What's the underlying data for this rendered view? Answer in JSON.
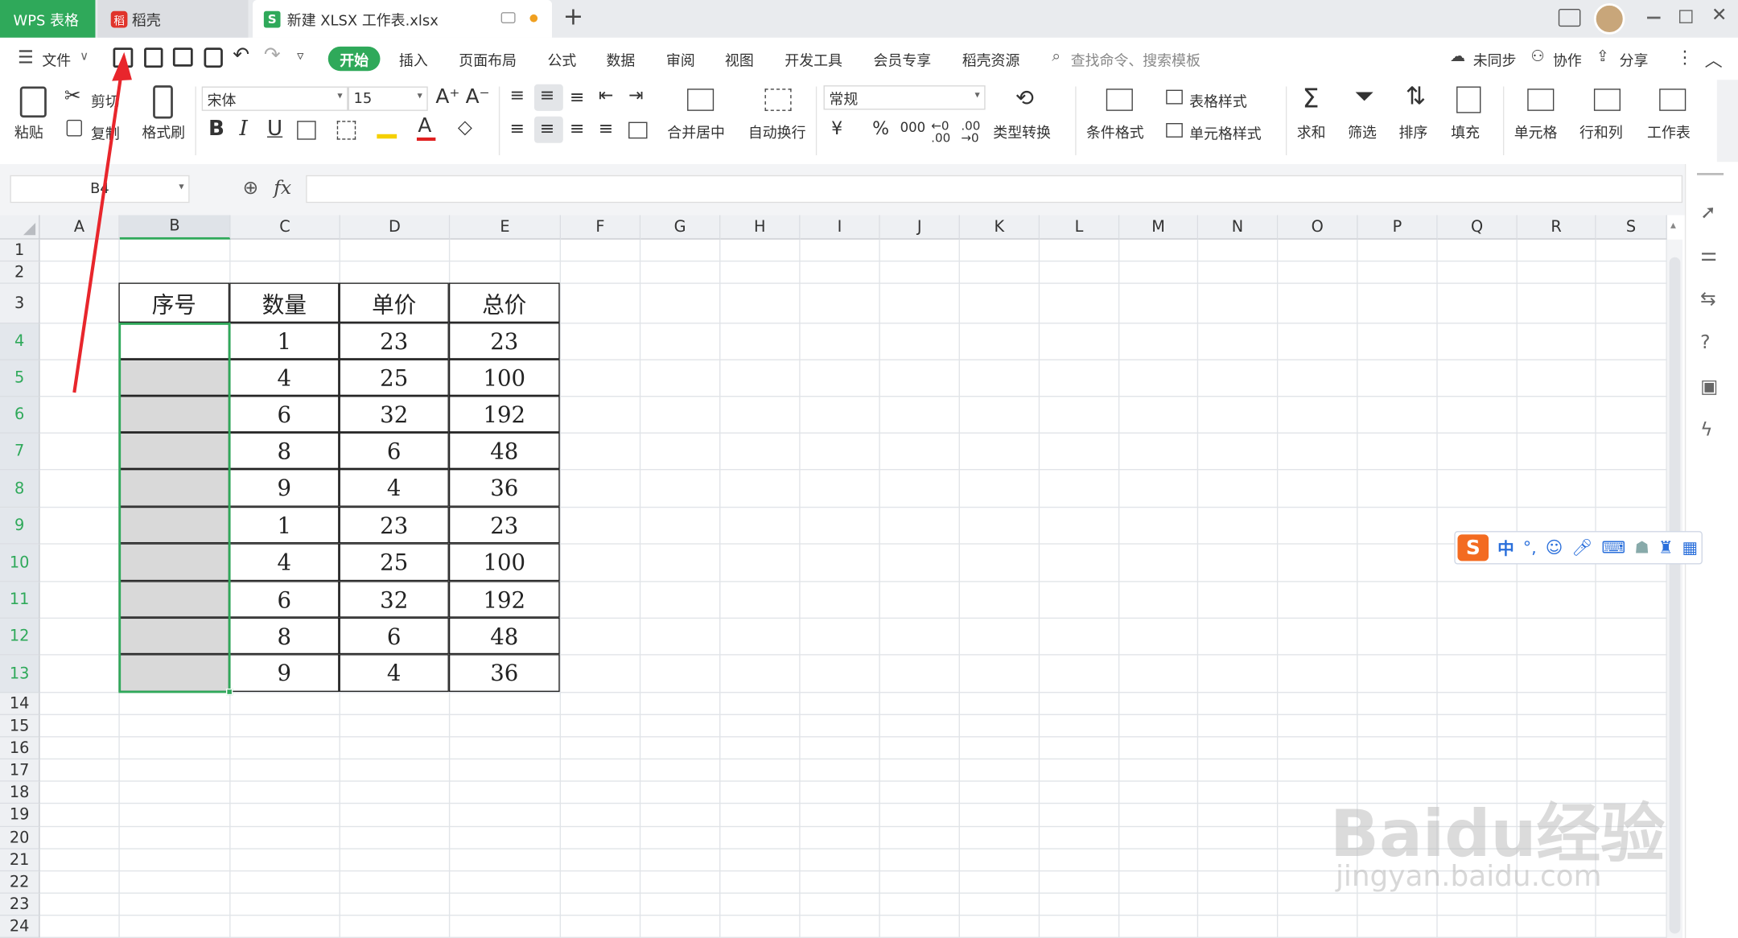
{
  "titlebar": {
    "tab_wps": "WPS 表格",
    "tab_daoke": "稻壳",
    "tab_file": "新建 XLSX 工作表.xlsx",
    "new_tab": "+"
  },
  "menubar": {
    "file": "文件",
    "items": [
      "开始",
      "插入",
      "页面布局",
      "公式",
      "数据",
      "审阅",
      "视图",
      "开发工具",
      "会员专享",
      "稻壳资源"
    ],
    "search": "查找命令、搜索模板",
    "sync": "未同步",
    "collab": "协作",
    "share": "分享"
  },
  "ribbon": {
    "paste": "粘贴",
    "cut": "剪切",
    "copy": "复制",
    "format_painter": "格式刷",
    "font_name": "宋体",
    "font_size": "15",
    "bold": "B",
    "italic": "I",
    "underline": "U",
    "merge_center": "合并居中",
    "auto_wrap": "自动换行",
    "number_format": "常规",
    "currency": "¥",
    "percent": "%",
    "thousands": "000",
    "type_convert": "类型转换",
    "cond_format": "条件格式",
    "table_style": "表格样式",
    "cell_style": "单元格样式",
    "sum": "求和",
    "filter": "筛选",
    "sort": "排序",
    "fill": "填充",
    "cell": "单元格",
    "row_col": "行和列",
    "worksheet": "工作表"
  },
  "formula_bar": {
    "name_box": "B4",
    "fx": "fx",
    "content": ""
  },
  "columns": [
    "A",
    "B",
    "C",
    "D",
    "E",
    "F",
    "G",
    "H",
    "I",
    "J",
    "K",
    "L",
    "M",
    "N",
    "O",
    "P",
    "Q",
    "R",
    "S"
  ],
  "rows": [
    "1",
    "2",
    "3",
    "4",
    "5",
    "6",
    "7",
    "8",
    "9",
    "10",
    "11",
    "12",
    "13",
    "14",
    "15",
    "16",
    "17",
    "18",
    "19",
    "20",
    "21",
    "22",
    "23",
    "24"
  ],
  "table": {
    "headers": [
      "序号",
      "数量",
      "单价",
      "总价"
    ],
    "rows": [
      [
        "",
        "1",
        "23",
        "23"
      ],
      [
        "",
        "4",
        "25",
        "100"
      ],
      [
        "",
        "6",
        "32",
        "192"
      ],
      [
        "",
        "8",
        "6",
        "48"
      ],
      [
        "",
        "9",
        "4",
        "36"
      ],
      [
        "",
        "1",
        "23",
        "23"
      ],
      [
        "",
        "4",
        "25",
        "100"
      ],
      [
        "",
        "6",
        "32",
        "192"
      ],
      [
        "",
        "8",
        "6",
        "48"
      ],
      [
        "",
        "9",
        "4",
        "36"
      ]
    ]
  },
  "ime": {
    "mode": "中",
    "punct": "°,"
  },
  "watermark": {
    "logo": "Baidu经验",
    "url": "jingyan.baidu.com"
  },
  "colors": {
    "accent": "#2fa95a",
    "selection_fill": "#d9d9d9",
    "annotation_arrow": "#e8262c"
  }
}
